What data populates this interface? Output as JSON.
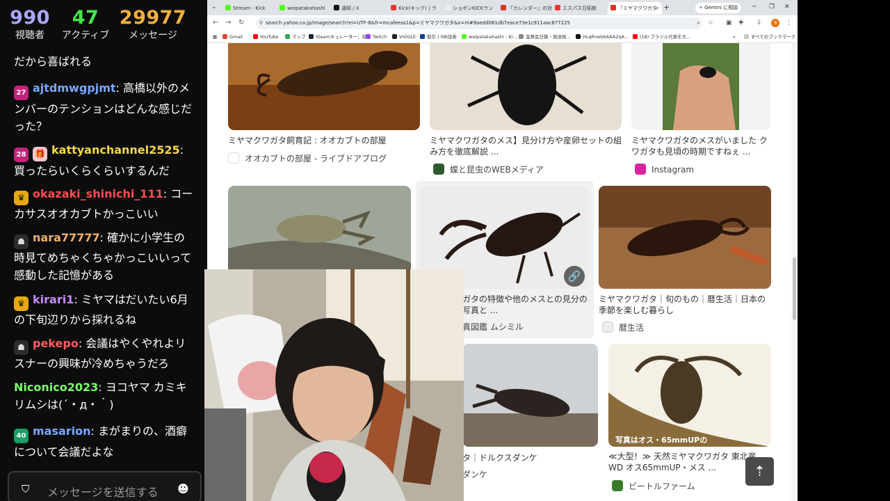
{
  "stats": {
    "viewers": {
      "value": "990",
      "label": "視聴者"
    },
    "active": {
      "value": "47",
      "label": "アクティブ"
    },
    "messages": {
      "value": "29977",
      "label": "メッセージ"
    }
  },
  "chat": {
    "messages": [
      {
        "user": "",
        "text": "だから喜ばれる",
        "badges": [],
        "color": "#ffffff"
      },
      {
        "user": "ajtdmwgpjmt",
        "text": "高橋以外のメンバーのテンションはどんな感じだった？",
        "badges": [
          "27"
        ],
        "color": "#7aa7ff"
      },
      {
        "user": "kattyanchannel2525",
        "text": "買ったらいくらくらいするんだ",
        "badges": [
          "28",
          "gift"
        ],
        "color": "#f6d94a"
      },
      {
        "user": "okazaki_shinichi_111",
        "text": "コーカサスオオカブトかっこいい",
        "badges": [
          "crown"
        ],
        "color": "#ff4d4d"
      },
      {
        "user": "nara77777",
        "text": "確かに小学生の時見てめちゃくちゃかっこいいって感動した記憶がある",
        "badges": [
          "ghost"
        ],
        "color": "#f3b06b"
      },
      {
        "user": "kirari1",
        "text": "ミヤマはだいたい6月の下旬辺りから採れるね",
        "badges": [
          "crown"
        ],
        "color": "#c58bff"
      },
      {
        "user": "pekepo",
        "text": "会議はやくやれよリスナーの興味が冷めちゃうだろ",
        "badges": [
          "ghost"
        ],
        "color": "#ff5c5c"
      },
      {
        "user": "Niconico2023",
        "text": "ヨコヤマ カミキリムシは(´・д・｀)",
        "badges": [],
        "color": "#7dff6b"
      },
      {
        "user": "masarion",
        "text": "まがまりの、酒癖について会議だよな",
        "badges": [
          "40"
        ],
        "color": "#7aa7ff"
      }
    ],
    "input_placeholder": "メッセージを送信する"
  },
  "browser": {
    "tabs": [
      "Stream - Kick",
      "weipatakahashi",
      "通知 / X",
      "Kick(キック) | ラ",
      "ショボンKICKラン",
      "「カレンダー」の対",
      "エスパス日拓新",
      "「ミヤマクワガタ"
    ],
    "new_tab": "+",
    "gemini": "Gemini に相談",
    "url": "search.yahoo.co.jp/image/search?ei=UTF-8&fr=mcafeess1&p=ミヤマクワガタ&x=nl#9aedd061db7eace73e1c911aac877225",
    "profile_initial": "9",
    "bookmarks": [
      "Gmail",
      "YouTube",
      "マップ",
      "Steamキュレーター：収...",
      "Twitch",
      "VIGGLE",
      "取引 | SBI証券",
      "weipatakahashi - Ki...",
      "金鉄会日報・放送局...",
      "HLqRnebbAAA2qA...",
      "(18) ブラジル代表を大..."
    ],
    "bookmarks_all": "すべてのブックマーク"
  },
  "results": [
    {
      "caption": "ミヤマクワガタ飼育記 : オオカブトの部屋",
      "source": "オオカブトの部屋 - ライブドアブログ",
      "color": "#c2247a"
    },
    {
      "caption": "ミヤマクワガタのメス】見分け方や産卵セットの組み方を徹底解説 ...",
      "source": "蝶と昆虫のWEBメディア",
      "color": "#2f5a2f"
    },
    {
      "caption": "ミヤマクワガタのメスがいました クワガタも見頃の時期ですねぇ ...",
      "source": "Instagram",
      "color": "#d6249f"
    },
    {
      "caption": "ガタの特徴や他のメスとの見分の写真と ...",
      "source": "真図鑑 ムシミル",
      "color": "#888888"
    },
    {
      "caption": "ミヤマクワガタ｜旬のもの｜暦生活｜日本の季節を楽しむ暮らし",
      "source": "暦生活",
      "color": "#bbbbbb"
    },
    {
      "caption": "タ｜ドルクスダンケ",
      "source": "ダンケ",
      "color": "#999999"
    },
    {
      "caption": "≪大型！≫ 天然ミヤマクワガタ 東北産 WD オス65mmUP・メス ...",
      "source": "ビートルファーム",
      "color": "#3a7a2a"
    }
  ],
  "image_overlay_text": "写真はオス・65mmUPの",
  "icons": {
    "link": "link-icon",
    "scroll_top": "arrow-up-icon",
    "shield": "shield-icon",
    "emoji": "emoji-icon"
  }
}
